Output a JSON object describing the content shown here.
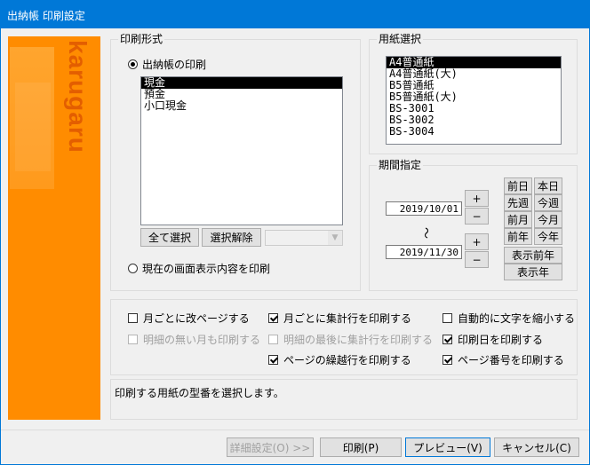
{
  "window": {
    "title": "出納帳 印刷設定"
  },
  "brand": {
    "text": "karugaru"
  },
  "print_format": {
    "title": "印刷形式",
    "option_ledger": "出納帳の印刷",
    "option_ledger_selected": true,
    "accounts": [
      {
        "label": "現金",
        "selected": true
      },
      {
        "label": "預金",
        "selected": false
      },
      {
        "label": "小口現金",
        "selected": false
      }
    ],
    "select_all_label": "全て選択",
    "deselect_label": "選択解除",
    "combo_value": "",
    "option_screen": "現在の画面表示内容を印刷",
    "option_screen_selected": false
  },
  "paper": {
    "title": "用紙選択",
    "items": [
      {
        "label": "A4普通紙",
        "selected": true
      },
      {
        "label": "A4普通紙(大)",
        "selected": false
      },
      {
        "label": "B5普通紙",
        "selected": false
      },
      {
        "label": "B5普通紙(大)",
        "selected": false
      },
      {
        "label": "BS-3001",
        "selected": false
      },
      {
        "label": "BS-3002",
        "selected": false
      },
      {
        "label": "BS-3004",
        "selected": false
      }
    ]
  },
  "period": {
    "title": "期間指定",
    "from_date": "2019/10/01",
    "to_date": "2019/11/30",
    "separator": "～",
    "plus": "+",
    "minus": "−",
    "prev_day": "前日",
    "today": "本日",
    "prev_week": "先週",
    "this_week": "今週",
    "prev_month": "前月",
    "this_month": "今月",
    "prev_year": "前年",
    "this_year": "今年",
    "display_prev_year": "表示前年",
    "display_year": "表示年"
  },
  "options": {
    "page_break_monthly": {
      "label": "月ごとに改ページする",
      "checked": false,
      "disabled": false
    },
    "print_empty_months": {
      "label": "明細の無い月も印刷する",
      "checked": false,
      "disabled": true
    },
    "monthly_total": {
      "label": "月ごとに集計行を印刷する",
      "checked": true,
      "disabled": false
    },
    "last_total": {
      "label": "明細の最後に集計行を印刷する",
      "checked": false,
      "disabled": true
    },
    "carryover": {
      "label": "ページの繰越行を印刷する",
      "checked": true,
      "disabled": false
    },
    "shrink_text": {
      "label": "自動的に文字を縮小する",
      "checked": false,
      "disabled": false
    },
    "print_date": {
      "label": "印刷日を印刷する",
      "checked": true,
      "disabled": false
    },
    "page_number": {
      "label": "ページ番号を印刷する",
      "checked": true,
      "disabled": false
    }
  },
  "message": "印刷する用紙の型番を選択します。",
  "footer": {
    "details": "詳細設定(O) >>",
    "print": "印刷(P)",
    "preview": "プレビュー(V)",
    "cancel": "キャンセル(C)"
  }
}
